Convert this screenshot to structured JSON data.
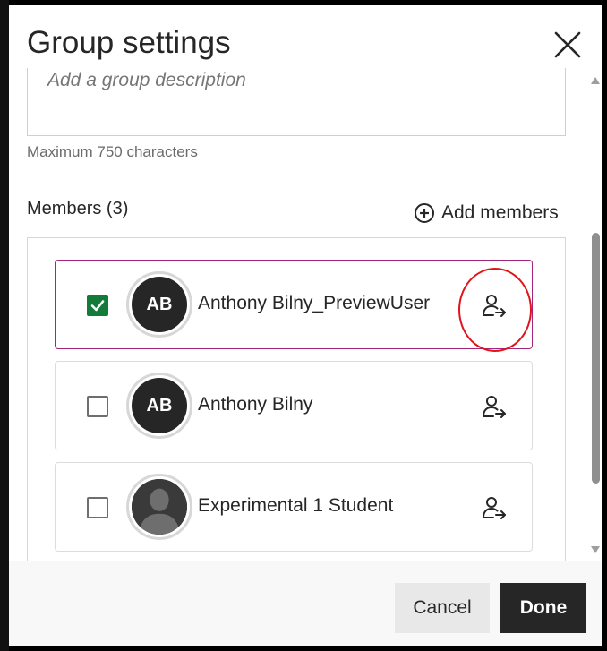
{
  "modal": {
    "title": "Group settings"
  },
  "description": {
    "placeholder": "Add a group description",
    "char_limit": "Maximum 750 characters"
  },
  "members": {
    "heading": "Members (3)",
    "add_label": "Add members",
    "list": [
      {
        "initials": "AB",
        "name": "Anthony Bilny_PreviewUser",
        "checked": true,
        "avatar": "initials"
      },
      {
        "initials": "AB",
        "name": "Anthony Bilny",
        "checked": false,
        "avatar": "initials"
      },
      {
        "initials": "",
        "name": "Experimental 1 Student",
        "checked": false,
        "avatar": "person-silhouette-icon"
      }
    ]
  },
  "footer": {
    "cancel_label": "Cancel",
    "done_label": "Done"
  },
  "colors": {
    "checked_green": "#127b3a",
    "selected_border": "#a1267a",
    "highlight_red": "#e0141b",
    "primary_dark": "#262626"
  },
  "icons": {
    "close": "close-icon",
    "add": "plus-circle-icon",
    "move": "person-arrow-icon",
    "check": "checkmark-icon"
  }
}
